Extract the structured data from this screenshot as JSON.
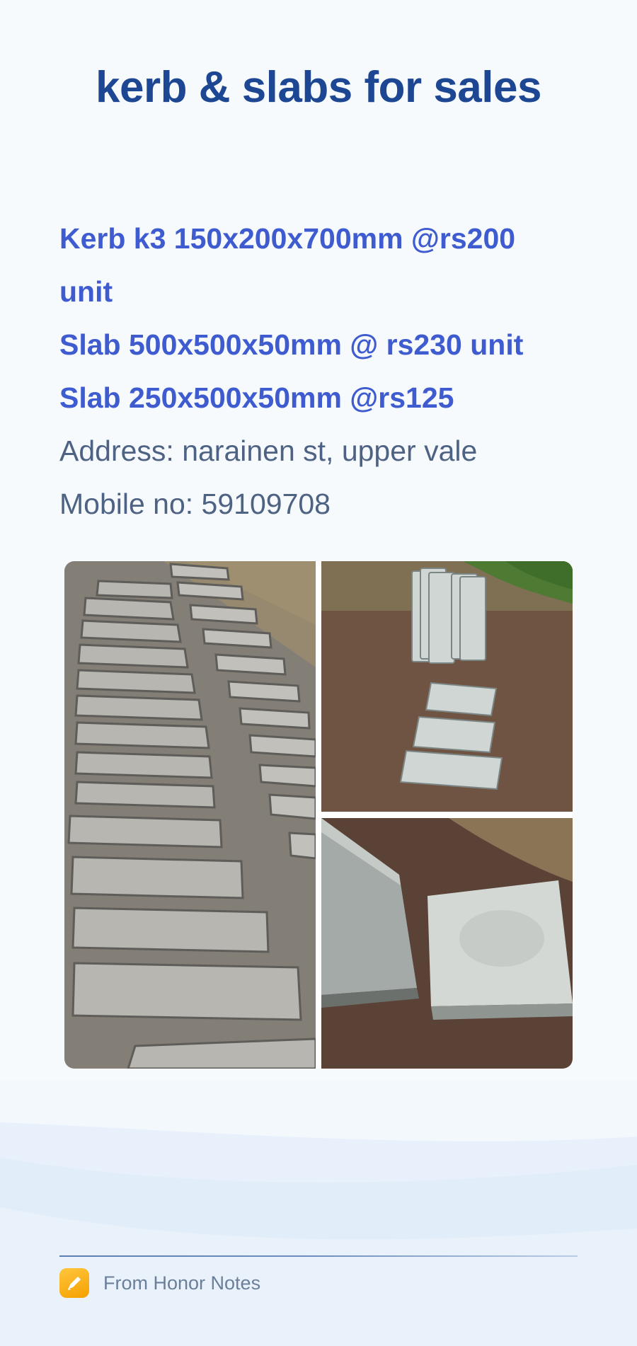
{
  "note": {
    "title": "kerb & slabs for sales",
    "lines": [
      "Kerb k3 150x200x700mm @rs200",
      "unit",
      "Slab 500x500x50mm @ rs230 unit",
      "Slab 250x500x50mm @rs125",
      "Address: narainen st, upper vale",
      "Mobile no: 59109708"
    ]
  },
  "photos": [
    {
      "name": "kerb-stones-photo",
      "icon": "kerbs-on-gravel"
    },
    {
      "name": "slab-stacks-photo",
      "icon": "slabs-on-soil"
    },
    {
      "name": "slab-closeup-photo",
      "icon": "slab-square"
    }
  ],
  "footer": {
    "source_label": "From Honor Notes",
    "icon": "notes-app-icon"
  },
  "colors": {
    "title": "#1d4693",
    "emphasis": "#3f5bd0",
    "body": "#4e6283",
    "app_icon": "#f5a100"
  }
}
